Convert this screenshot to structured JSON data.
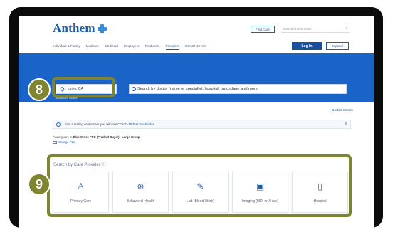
{
  "header": {
    "logo_text": "Anthem",
    "find_care": "Find Care",
    "search_placeholder": "Search Anthem.com",
    "login": "Log In",
    "espanol": "Español",
    "nav": [
      "Individual & Family",
      "Medicare",
      "Medicaid",
      "Employers",
      "Producers",
      "Providers",
      "COVID-19 Info"
    ],
    "active_nav": "Providers"
  },
  "hero": {
    "location": "Irvine, CA",
    "search_placeholder": "Search by doctor (name or specialty), hospital, procedure, and more",
    "advanced_search": "Advanced Search"
  },
  "content": {
    "guided_search": "Guided Search",
    "notice_text": "Find a testing center near you with our",
    "notice_link": "COVID-19 Test Site Finder",
    "plan_prefix": "Finding care in",
    "plan_name": "Blue Cross PPO (Prudent Buyer) - Large Group",
    "change_plan": "Change Plan",
    "section_title": "Search by Care Provider",
    "providers": [
      {
        "label": "Primary Care",
        "icon": "doctor-icon"
      },
      {
        "label": "Behavioral Health",
        "icon": "brain-icon"
      },
      {
        "label": "Lab (Blood Work)",
        "icon": "pipette-icon"
      },
      {
        "label": "Imaging (MRI or X-ray)",
        "icon": "xray-icon"
      },
      {
        "label": "Hospital",
        "icon": "hospital-icon"
      }
    ]
  },
  "annotations": {
    "step_8": "8",
    "step_9": "9"
  },
  "colors": {
    "brand_blue": "#1a63c7",
    "annotation_olive": "#7f8430"
  }
}
